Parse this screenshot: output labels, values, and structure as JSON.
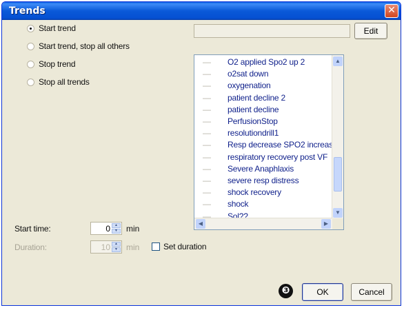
{
  "window": {
    "title": "Trends",
    "close_glyph": "✕"
  },
  "radio_options": [
    {
      "label": "Start trend",
      "checked": true
    },
    {
      "label": "Start trend, stop all others",
      "checked": false
    },
    {
      "label": "Stop trend",
      "checked": false
    },
    {
      "label": "Stop all trends",
      "checked": false
    }
  ],
  "trend_name": {
    "value": ""
  },
  "edit_button": {
    "label": "Edit"
  },
  "trend_list": {
    "items": [
      "O2 applied Spo2 up 2",
      "o2sat down",
      "oxygenation",
      "patient decline 2",
      "patient decline",
      "PerfusionStop",
      "resolutiondrill1",
      "Resp decrease SPO2 increas",
      "respiratory recovery post VF",
      "Severe Anaphlaxis",
      "severe resp distress",
      "shock recovery",
      "shock",
      "Sol?? ... "
    ]
  },
  "start_time": {
    "label": "Start time:",
    "value": "0",
    "unit": "min"
  },
  "duration": {
    "label": "Duration:",
    "value": "10",
    "unit": "min",
    "disabled": true
  },
  "set_duration": {
    "label": "Set duration",
    "checked": false
  },
  "callout": {
    "label": "❸"
  },
  "ok_button": {
    "label": "OK"
  },
  "cancel_button": {
    "label": "Cancel"
  }
}
